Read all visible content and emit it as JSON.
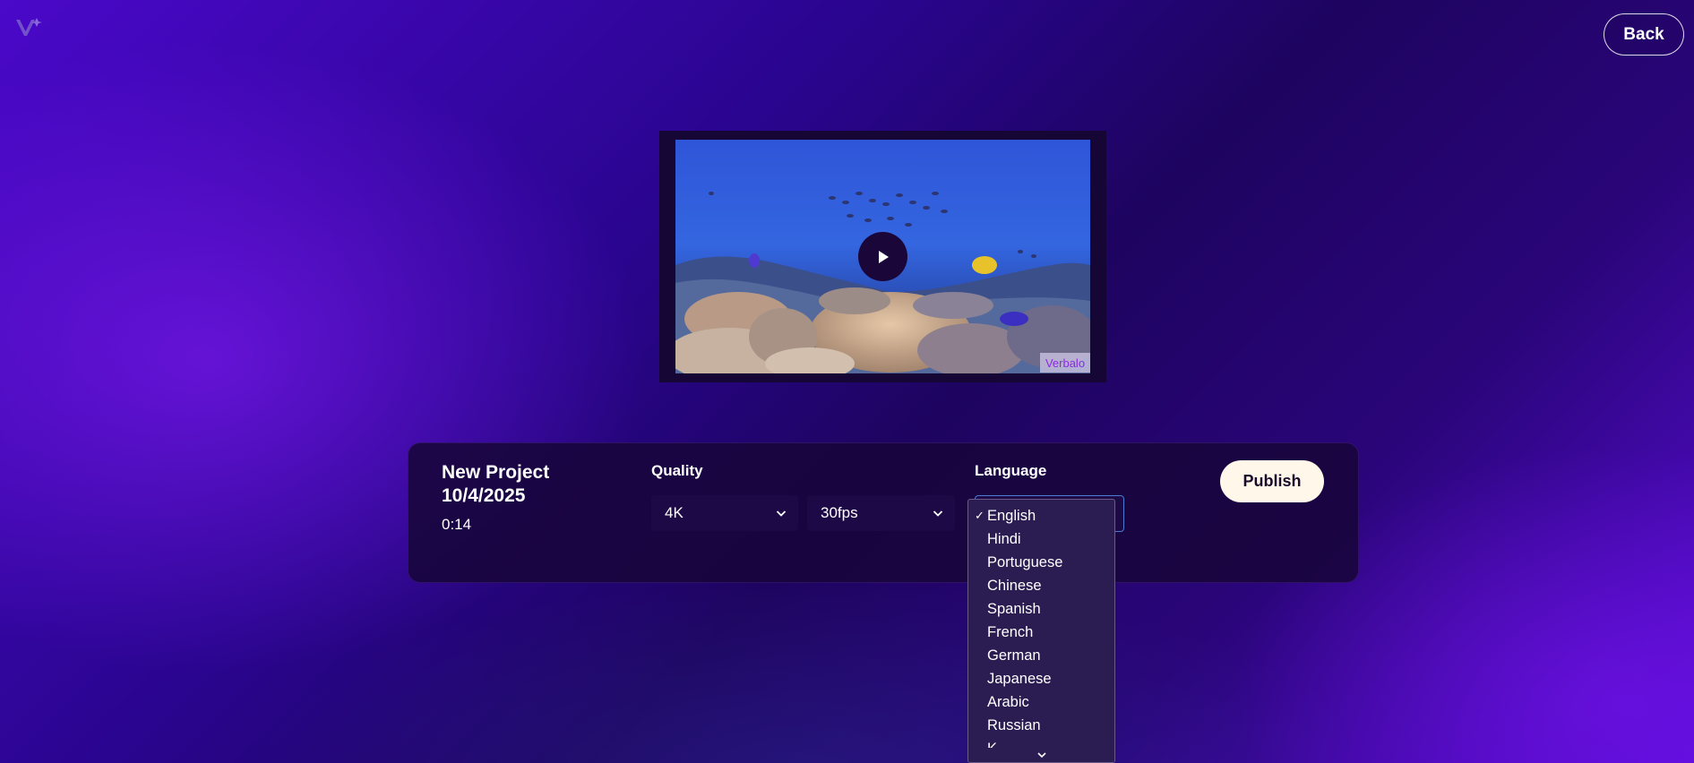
{
  "header": {
    "back_label": "Back"
  },
  "video": {
    "watermark": "Verbalo"
  },
  "project": {
    "title_line1": "New Project",
    "title_line2": "10/4/2025",
    "duration": "0:14"
  },
  "quality": {
    "label": "Quality",
    "resolution": "4K",
    "framerate": "30fps"
  },
  "language": {
    "label": "Language",
    "selected_mark": "✓",
    "options": [
      "English",
      "Hindi",
      "Portuguese",
      "Chinese",
      "Spanish",
      "French",
      "German",
      "Japanese",
      "Arabic",
      "Russian",
      "K"
    ]
  },
  "actions": {
    "publish_label": "Publish"
  },
  "colors": {
    "publish_bg": "#fff8ea",
    "watermark_text": "#8a2be2",
    "focus_border": "#4b7bd6"
  },
  "icons": {
    "logo": "v-logo-icon",
    "play": "play-icon",
    "chevron": "chevron-down-icon"
  }
}
